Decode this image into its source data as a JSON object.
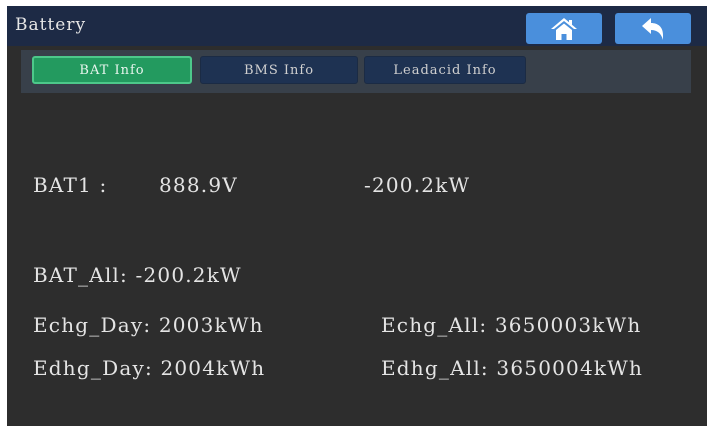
{
  "header": {
    "title": "Battery",
    "home_icon": "home-icon",
    "back_icon": "back-arrow-icon"
  },
  "tabs": [
    {
      "label": "BAT Info",
      "active": true
    },
    {
      "label": "BMS Info",
      "active": false
    },
    {
      "label": "Leadacid Info",
      "active": false
    }
  ],
  "bat1": {
    "label": "BAT1 :",
    "voltage": "888.9V",
    "power": "-200.2kW"
  },
  "bat_all": "BAT_All: -200.2kW",
  "echg_day": "Echg_Day: 2003kWh",
  "echg_all": "Echg_All: 3650003kWh",
  "edhg_day": "Edhg_Day: 2004kWh",
  "edhg_all": "Edhg_All: 3650004kWh",
  "colors": {
    "header_bg": "#1d2a45",
    "button_blue": "#4a8fdc",
    "tab_active": "#239a5f",
    "tab_inactive": "#1e3252",
    "screen_bg": "#2d2d2d"
  }
}
